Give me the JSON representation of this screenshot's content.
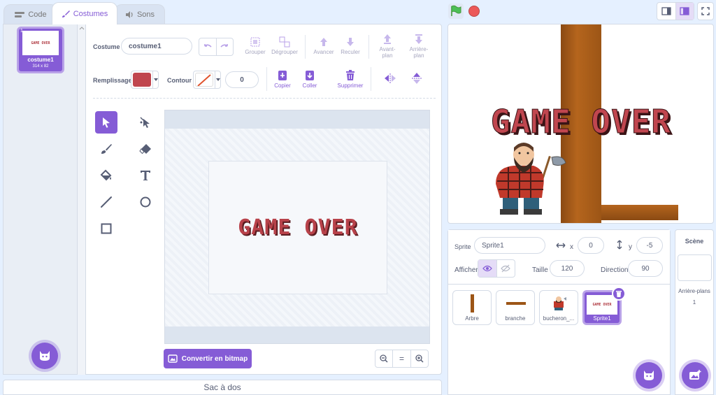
{
  "tabs": {
    "code": "Code",
    "costumes": "Costumes",
    "sounds": "Sons"
  },
  "costume_list": [
    {
      "index": "1",
      "thumb_text": "GAME OVER",
      "name": "costume1",
      "size": "314 x 82"
    }
  ],
  "toolbar": {
    "costume_label": "Costume",
    "costume_name": "costume1",
    "group": "Grouper",
    "ungroup": "Dégrouper",
    "forward": "Avancer",
    "backward": "Reculer",
    "front": "Avant-\nplan",
    "back": "Arrière-\nplan",
    "fill_label": "Remplissage",
    "outline_label": "Contour",
    "outline_width": "0",
    "copy": "Copier",
    "paste": "Coller",
    "delete": "Supprimer"
  },
  "canvas": {
    "text": "GAME OVER"
  },
  "convert_button": "Convertir en bitmap",
  "zoom": {
    "reset": "="
  },
  "backpack": "Sac à dos",
  "stage": {
    "text": "GAME OVER"
  },
  "sprite_info": {
    "sprite_label": "Sprite",
    "sprite_name": "Sprite1",
    "x_label": "x",
    "x": "0",
    "y_label": "y",
    "y": "-5",
    "show_label": "Afficher",
    "size_label": "Taille",
    "size": "120",
    "direction_label": "Direction",
    "direction": "90"
  },
  "sprites": [
    {
      "name": "Arbre"
    },
    {
      "name": "branche"
    },
    {
      "name": "bucheron_..."
    },
    {
      "name": "Sprite1",
      "thumb_text": "GAME OVER"
    }
  ],
  "scene": {
    "title": "Scène",
    "backdrops_label": "Arrière-plans",
    "backdrops_count": "1"
  },
  "colors": {
    "accent": "#855cd6",
    "fill": "#c0464f",
    "green_flag": "#4cbf56",
    "stop": "#ec5959"
  }
}
